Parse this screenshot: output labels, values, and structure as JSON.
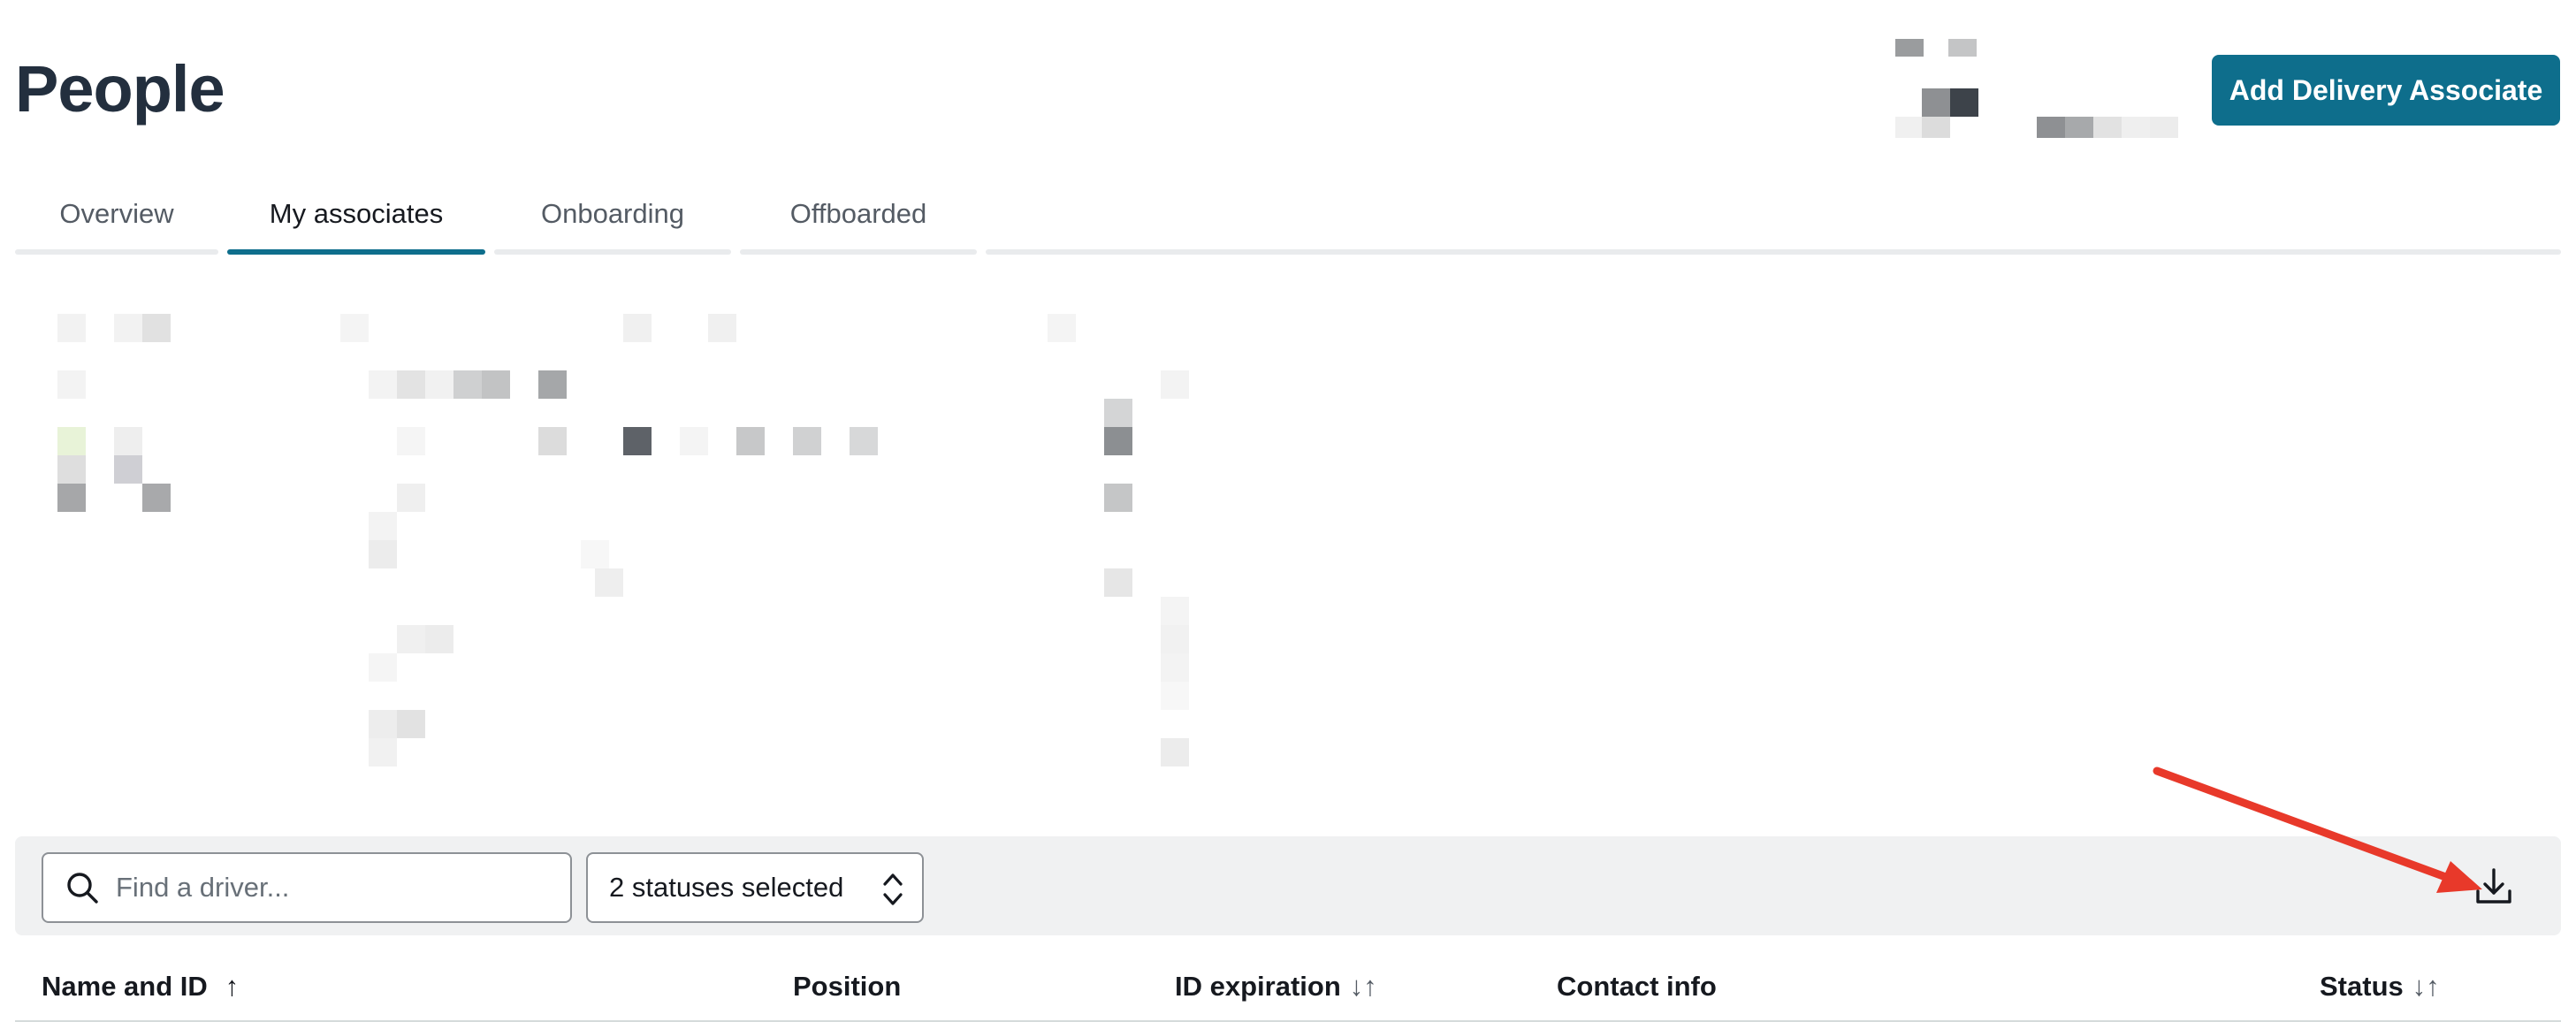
{
  "page": {
    "title": "People"
  },
  "header": {
    "add_button_label": "Add Delivery Associate"
  },
  "tabs": [
    {
      "label": "Overview",
      "active": false
    },
    {
      "label": "My associates",
      "active": true
    },
    {
      "label": "Onboarding",
      "active": false
    },
    {
      "label": "Offboarded",
      "active": false
    }
  ],
  "toolbar": {
    "search_placeholder": "Find a driver...",
    "search_value": "",
    "status_filter_label": "2 statuses selected",
    "download_icon": "download-icon"
  },
  "table": {
    "columns": [
      {
        "label": "Name and ID",
        "sort": "↑"
      },
      {
        "label": "Position",
        "sort": ""
      },
      {
        "label": "ID expiration",
        "sort": "↓↑"
      },
      {
        "label": "Contact info",
        "sort": ""
      },
      {
        "label": "Status",
        "sort": "↓↑"
      }
    ]
  },
  "colors": {
    "accent": "#0e6e8c",
    "annotation_arrow": "#e8392a"
  }
}
